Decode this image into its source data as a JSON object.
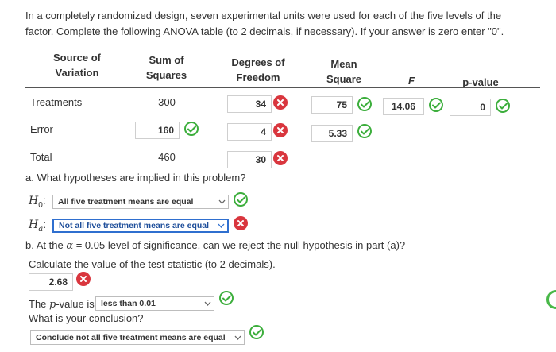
{
  "intro": "In a completely randomized design, seven experimental units were used for each of the five levels of the factor. Complete the following ANOVA table (to 2 decimals, if necessary). If your answer is zero enter \"0\".",
  "headers": {
    "source_line1": "Source of",
    "source_line2": "Variation",
    "ss_line1": "Sum of",
    "ss_line2": "Squares",
    "df_line1": "Degrees of",
    "df_line2": "Freedom",
    "ms_line1": "Mean",
    "ms_line2": "Square",
    "f": "F",
    "p": "p-value"
  },
  "rows": {
    "treatments": {
      "label": "Treatments",
      "ss": "300",
      "df": "34",
      "df_status": "incorrect",
      "ms": "75",
      "ms_status": "correct",
      "f": "14.06",
      "f_status": "correct",
      "p": "0",
      "p_status": "correct"
    },
    "error": {
      "label": "Error",
      "ss": "160",
      "ss_status": "correct",
      "df": "4",
      "df_status": "incorrect",
      "ms": "5.33",
      "ms_status": "correct"
    },
    "total": {
      "label": "Total",
      "ss": "460",
      "df": "30",
      "df_status": "incorrect"
    }
  },
  "part_a": {
    "question": "a. What hypotheses are implied in this problem?",
    "h0_symbol": "H",
    "h0_sub": "0",
    "h0_value": "All five treatment means are equal",
    "h0_status": "correct",
    "ha_symbol": "H",
    "ha_sub": "a",
    "ha_value": "Not all five treatment means are equal",
    "ha_status": "incorrect"
  },
  "part_b": {
    "question_pre": "b. At the ",
    "alpha": "α",
    "question_post": " = 0.05 level of significance, can we reject the null hypothesis in part (a)?",
    "calc_prompt": "Calculate the value of the test statistic (to 2 decimals).",
    "test_stat": "2.68",
    "test_stat_status": "incorrect",
    "pvalue_pre": "The ",
    "pvalue_p": "p",
    "pvalue_post": "-value is",
    "pvalue_value": "less than 0.01",
    "pvalue_status": "correct",
    "conclusion_prompt": "What is your conclusion?",
    "conclusion_value": "Conclude not all five treatment means are equal",
    "conclusion_status": "correct"
  },
  "colors": {
    "correct": "#3cae3c",
    "incorrect": "#d9363e",
    "selected_border": "#2f6fcf"
  },
  "icons": {
    "correct": "checkmark-icon",
    "incorrect": "x-icon",
    "dropdown": "chevron-down-icon"
  }
}
